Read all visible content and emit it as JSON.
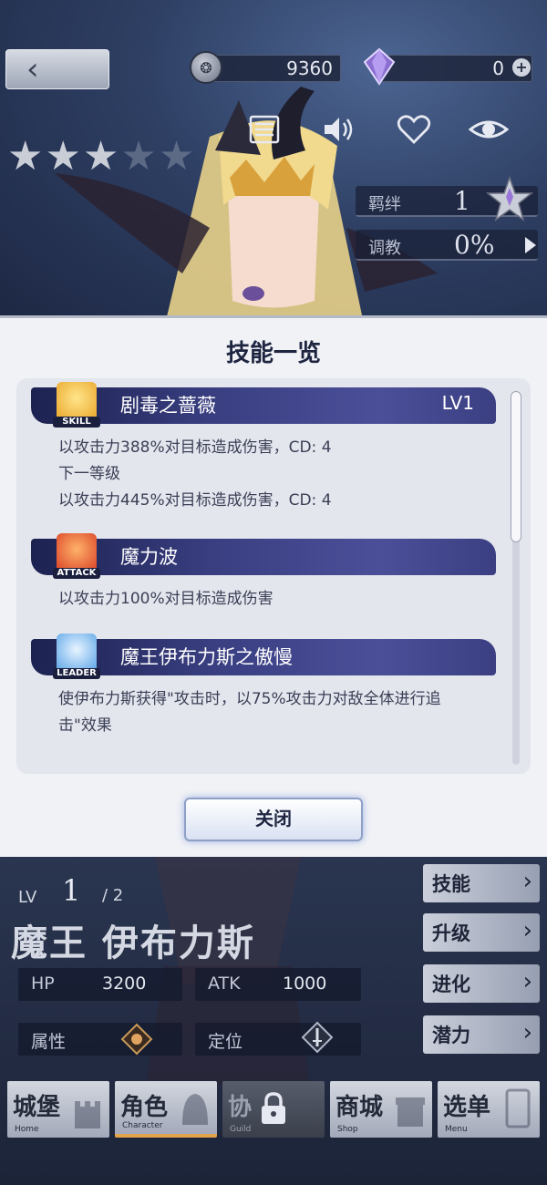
{
  "header": {
    "back_icon": "chevron-left-icon",
    "gold": "9360",
    "gems": "0",
    "toolbar_icons": [
      "profile-card-icon",
      "speaker-icon",
      "heart-icon",
      "eye-icon"
    ]
  },
  "character_stats": {
    "stars_total": 5,
    "stars_filled": 3,
    "bond_label": "羁绊",
    "bond_value": "1",
    "training_label": "调教",
    "training_value": "0%"
  },
  "modal": {
    "title": "技能一览",
    "close_label": "关闭",
    "skills": [
      {
        "badge": "SKILL",
        "name": "剧毒之蔷薇",
        "level": "LV1",
        "lines": [
          "以攻击力388%对目标造成伤害，CD: 4",
          "下一等级",
          "以攻击力445%对目标造成伤害，CD: 4"
        ]
      },
      {
        "badge": "ATTACK",
        "name": "魔力波",
        "level": "",
        "lines": [
          "以攻击力100%对目标造成伤害"
        ]
      },
      {
        "badge": "LEADER",
        "name": "魔王伊布力斯之傲慢",
        "level": "",
        "lines": [
          "使伊布力斯获得\"攻击时，以75%攻击力对敌全体进行追",
          "击\"效果"
        ]
      }
    ]
  },
  "character": {
    "lv_label": "LV",
    "lv": "1",
    "lv_max": "/ 2",
    "name": "魔王 伊布力斯",
    "hp_label": "HP",
    "hp": "3200",
    "atk_label": "ATK",
    "atk": "1000",
    "attribute_label": "属性",
    "role_label": "定位"
  },
  "side_menu": [
    "技能",
    "升级",
    "进化",
    "潜力"
  ],
  "bottom_nav": [
    {
      "cn": "城堡",
      "en": "Home"
    },
    {
      "cn": "角色",
      "en": "Character"
    },
    {
      "cn": "协",
      "en": "Guild"
    },
    {
      "cn": "商城",
      "en": "Shop"
    },
    {
      "cn": "选单",
      "en": "Menu"
    }
  ],
  "colors": {
    "skill_bar": "#3a3f82",
    "modal_bg": "#f1f2f6",
    "active_tab": "#e2a44a"
  }
}
